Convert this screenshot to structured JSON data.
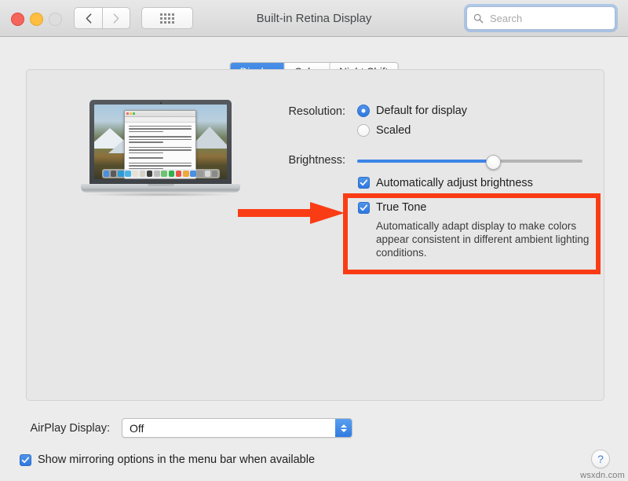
{
  "window": {
    "title": "Built-in Retina Display",
    "traffic_lights": [
      "close",
      "minimize",
      "zoom"
    ],
    "nav_back_icon": "chevron-left-icon",
    "nav_forward_icon": "chevron-right-icon",
    "show_all_icon": "grid-icon"
  },
  "search": {
    "placeholder": "Search",
    "value": "",
    "icon": "search-icon"
  },
  "tabs": [
    {
      "label": "Display",
      "selected": true
    },
    {
      "label": "Color",
      "selected": false
    },
    {
      "label": "Night Shift",
      "selected": false
    }
  ],
  "display_preview": {
    "device": "MacBook Pro",
    "wallpaper": "macOS High Sierra mountain",
    "window_on_screen": "TextEdit document"
  },
  "resolution": {
    "label": "Resolution:",
    "options": [
      {
        "label": "Default for display",
        "selected": true
      },
      {
        "label": "Scaled",
        "selected": false
      }
    ]
  },
  "brightness": {
    "label": "Brightness:",
    "value_percent": 60
  },
  "auto_brightness": {
    "label": "Automatically adjust brightness",
    "checked": true
  },
  "true_tone": {
    "label": "True Tone",
    "checked": true,
    "description": "Automatically adapt display to make colors appear consistent in different ambient lighting conditions.",
    "highlight_color": "#fa3c15",
    "annotation_icon": "red-arrow-icon"
  },
  "airplay": {
    "label": "AirPlay Display:",
    "value": "Off",
    "options": [
      "Off"
    ]
  },
  "mirroring": {
    "label": "Show mirroring options in the menu bar when available",
    "checked": true
  },
  "help": {
    "label": "?"
  },
  "watermark": {
    "text": "wsxdn.com"
  },
  "colors": {
    "accent": "#2f78e0",
    "highlight": "#fa3c15",
    "window_bg": "#ececec",
    "panel_bg": "#e7e7e7"
  }
}
